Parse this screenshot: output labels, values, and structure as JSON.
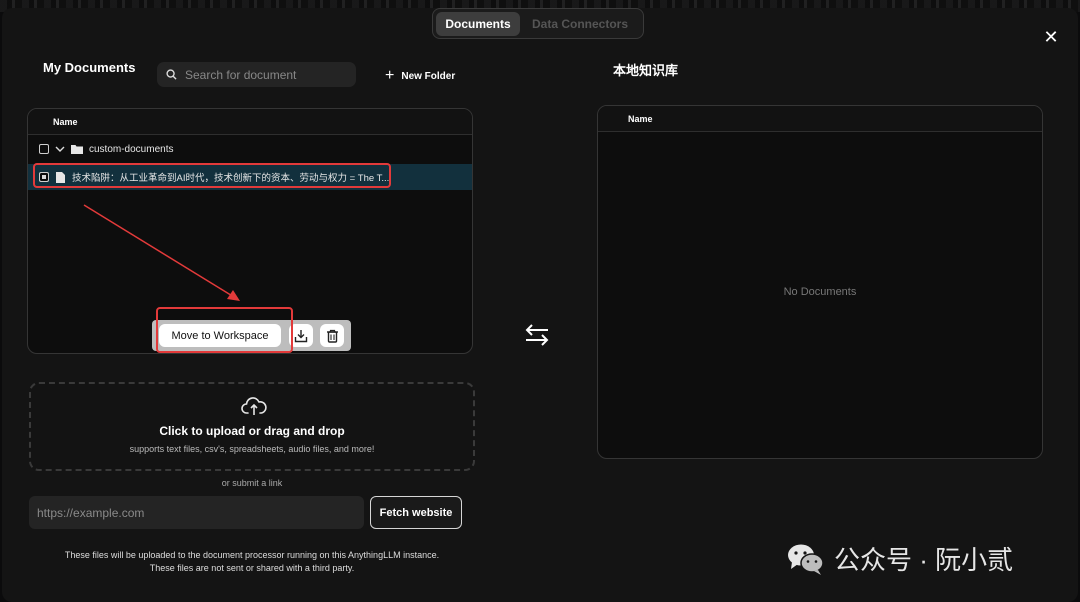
{
  "tabs": [
    {
      "label": "Documents",
      "active": true
    },
    {
      "label": "Data Connectors",
      "active": false
    }
  ],
  "left": {
    "title": "My Documents",
    "search_placeholder": "Search for document",
    "new_folder_label": "New Folder",
    "column_name": "Name",
    "folder": {
      "name": "custom-documents"
    },
    "file": {
      "name": "技术陷阱：从工业革命到AI时代，技术创新下的资本、劳动与权力 = The T..."
    },
    "actions": {
      "move_label": "Move to Workspace"
    }
  },
  "upload": {
    "title": "Click to upload or drag and drop",
    "subtitle": "supports text files, csv's, spreadsheets, audio files, and more!",
    "or_link": "or submit a link",
    "url_placeholder": "https://example.com",
    "fetch_label": "Fetch website",
    "disclaimer_line1": "These files will be uploaded to the document processor running on this AnythingLLM instance.",
    "disclaimer_line2": "These files are not sent or shared with a third party."
  },
  "right": {
    "title": "本地知识库",
    "column_name": "Name",
    "empty_text": "No Documents"
  },
  "watermark": "公众号 · 阮小贰",
  "colors": {
    "annotation_red": "#e23a3a",
    "modal_bg": "#141414",
    "selected_row": "#12303d"
  }
}
